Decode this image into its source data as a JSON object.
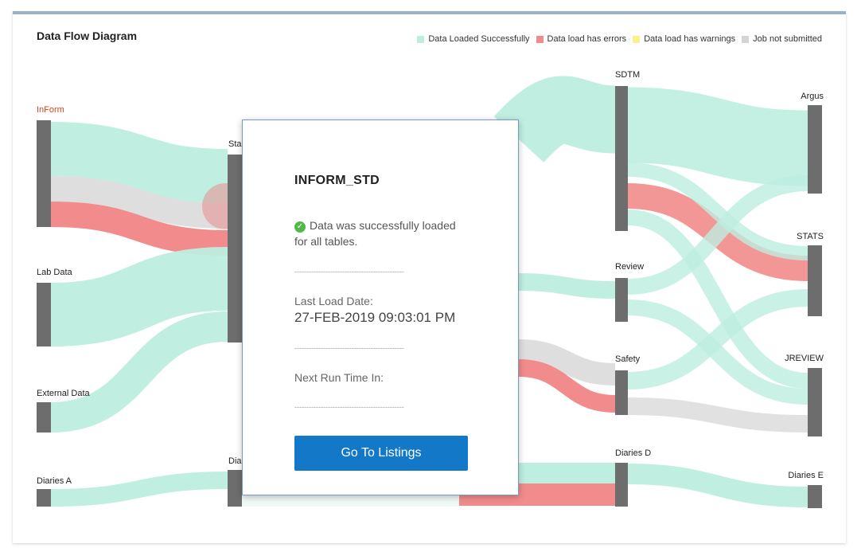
{
  "header": {
    "title": "Data Flow Diagram"
  },
  "legend": [
    {
      "label": "Data Loaded Successfully",
      "color": "#bdeee0"
    },
    {
      "label": "Data load has errors",
      "color": "#f28b8b"
    },
    {
      "label": "Data load has warnings",
      "color": "#f7f28a"
    },
    {
      "label": "Job not submitted",
      "color": "#d4d4d4"
    }
  ],
  "nodes": {
    "inform": "InForm",
    "lab_data": "Lab Data",
    "external_data": "External Data",
    "diaries_a": "Diaries A",
    "staging": "Sta",
    "diaries_mid": "Dia",
    "sdtm": "SDTM",
    "review": "Review",
    "safety": "Safety",
    "diaries_d": "Diaries D",
    "argus": "Argus",
    "stats": "STATS",
    "jreview": "JREVIEW",
    "diaries_e": "Diaries E"
  },
  "colors": {
    "success": "#bdeee0",
    "error": "#f28b8b",
    "warning": "#f7f28a",
    "not_submitted": "#dedede",
    "node": "#6d6d6d",
    "active_label": "#e2401c"
  },
  "popup": {
    "title": "INFORM_STD",
    "status_icon": "check-circle-icon",
    "status_text": "Data was successfully loaded for all tables.",
    "separator": "----------------------------------------------",
    "last_load_label": "Last Load Date:",
    "last_load_value": "27-FEB-2019 09:03:01 PM",
    "next_run_label": "Next Run Time In:",
    "button_label": "Go To Listings"
  }
}
